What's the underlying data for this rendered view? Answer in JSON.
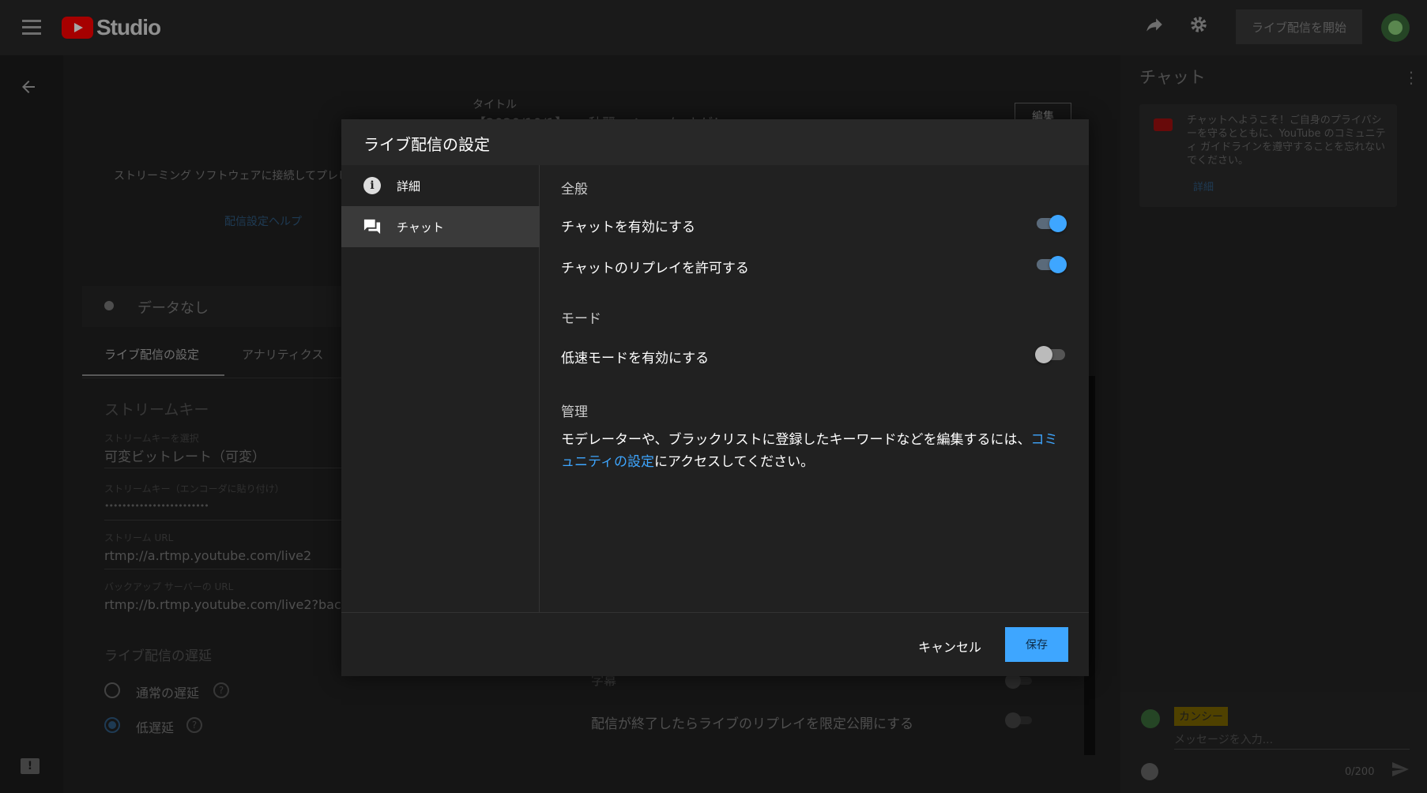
{
  "header": {
    "logo_text": "Studio",
    "go_live_label": "ライブ配信を開始"
  },
  "background_page": {
    "title_label": "タイトル",
    "title_value": "【2020/10/1】 ● 秋麗 ャン ー ケ ナゲ！",
    "edit_label": "編集",
    "streaming_hint": "ストリーミング ソフトウェアに接続してプレビューを",
    "settings_help": "配信設定ヘルプ",
    "no_data": "データなし",
    "tabs": [
      "ライブ配信の設定",
      "アナリティクス"
    ],
    "stream_key_heading": "ストリームキー",
    "stream_key_select_label": "ストリームキーを選択",
    "stream_key_select_value": "可変ビットレート（可変）",
    "stream_key_paste_label": "ストリームキー（エンコーダに貼り付け）",
    "stream_key_masked": "••••••••••••••••••••••••",
    "stream_url_label": "ストリーム URL",
    "stream_url_value": "rtmp://a.rtmp.youtube.com/live2",
    "backup_url_label": "バックアップ サーバーの URL",
    "backup_url_value": "rtmp://b.rtmp.youtube.com/live2?backu",
    "latency_heading": "ライブ配信の遅延",
    "latency_options": [
      "通常の遅延",
      "低遅延"
    ],
    "subtitle_label": "字幕",
    "replay_unlisted_label": "配信が終了したらライブのリプレイを限定公開にする"
  },
  "chat_panel": {
    "title": "チャット",
    "welcome_text": "チャットへようこそ！ご自身のプライバシーを守るとともに、YouTube のコミュニティ ガイドラインを遵守することを忘れないでください。",
    "welcome_link": "詳細",
    "user_name": "カンシー",
    "input_placeholder": "メッセージを入力...",
    "char_count": "0/200"
  },
  "modal": {
    "title": "ライブ配信の設定",
    "sidebar": [
      {
        "label": "詳細",
        "icon": "info-icon",
        "active": false
      },
      {
        "label": "チャット",
        "icon": "chat-icon",
        "active": true
      }
    ],
    "general_heading": "全般",
    "settings": {
      "enable_chat": {
        "label": "チャットを有効にする",
        "on": true
      },
      "allow_replay": {
        "label": "チャットのリプレイを許可する",
        "on": true
      }
    },
    "mode_heading": "モード",
    "slow_mode": {
      "label": "低速モードを有効にする",
      "on": false
    },
    "manage_heading": "管理",
    "manage_text_before": "モデレーターや、ブラックリストに登録したキーワードなどを編集するには、",
    "manage_link": "コミュニティの設定",
    "manage_text_after": "にアクセスしてください。",
    "cancel_label": "キャンセル",
    "save_label": "保存"
  },
  "colors": {
    "accent": "#3ea6ff",
    "modal_bg": "#212121",
    "header_bg": "#282828"
  }
}
